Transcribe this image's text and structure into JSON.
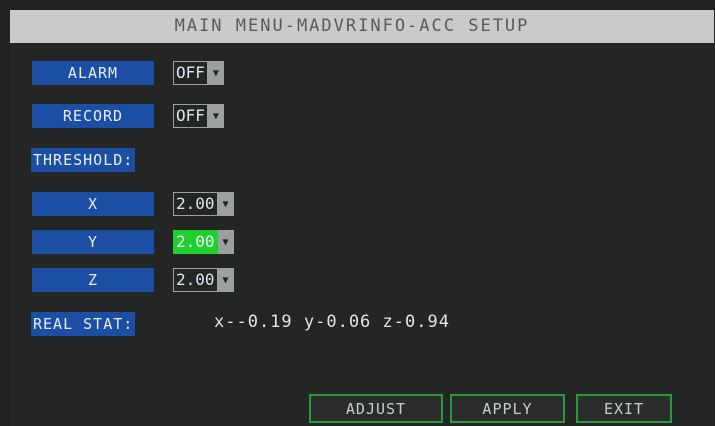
{
  "title": "MAIN MENU-MADVRINFO-ACC SETUP",
  "alarm": {
    "label": "ALARM",
    "value": "OFF"
  },
  "record": {
    "label": "RECORD",
    "value": "OFF"
  },
  "threshold": {
    "label": "THRESHOLD:",
    "x": {
      "label": "X",
      "value": "2.00"
    },
    "y": {
      "label": "Y",
      "value": "2.00"
    },
    "z": {
      "label": "Z",
      "value": "2.00"
    }
  },
  "real_stat": {
    "label": "REAL STAT:",
    "values": "x--0.19 y-0.06 z-0.94"
  },
  "buttons": {
    "adjust": "ADJUST",
    "apply": "APPLY",
    "exit": "EXIT"
  },
  "colors": {
    "label_bg": "#1c4fa3",
    "highlight": "#1fcf2d",
    "button_border": "#2a9b3a",
    "title_bg": "#c9cbc8"
  },
  "icons": {
    "dropdown": "triangle-down"
  }
}
